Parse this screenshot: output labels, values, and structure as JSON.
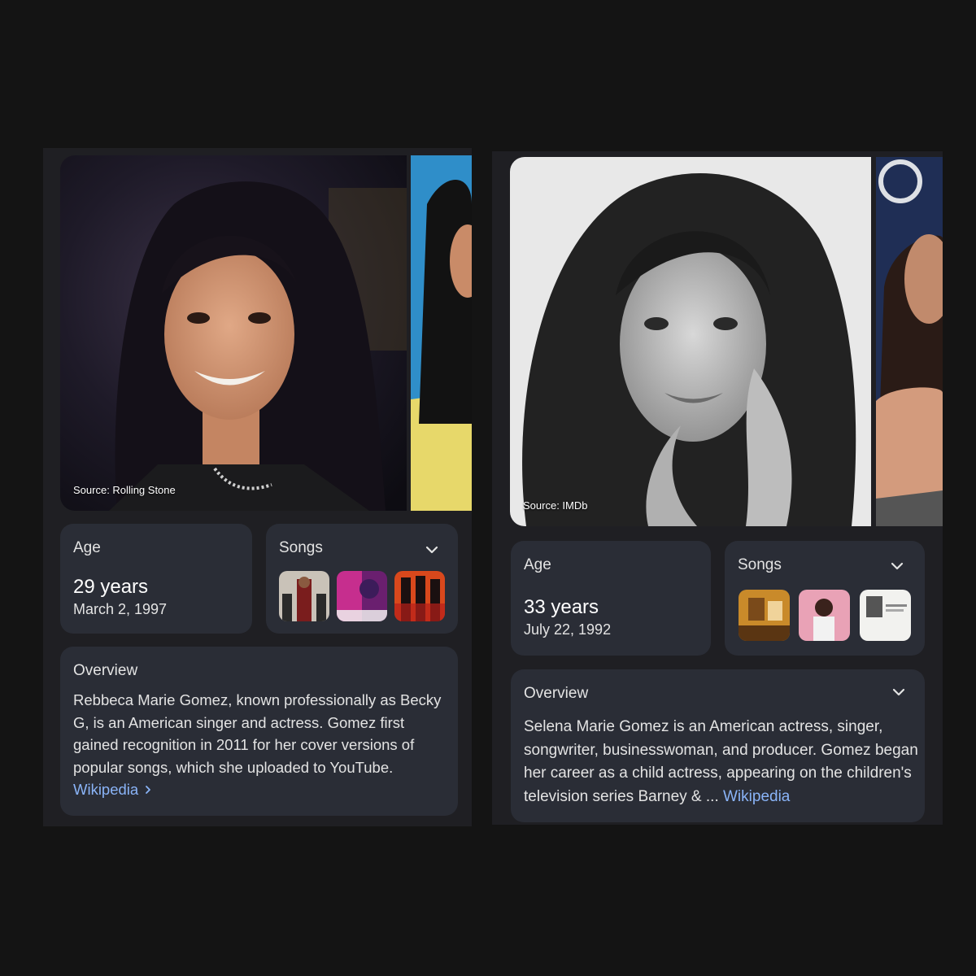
{
  "left_panel": {
    "photo_source": "Source: Rolling Stone",
    "age": {
      "label": "Age",
      "value": "29 years",
      "date": "March 2, 1997"
    },
    "songs": {
      "label": "Songs",
      "expand_icon": "chevron-down-icon"
    },
    "overview": {
      "label": "Overview",
      "text": "Rebbeca Marie Gomez, known professionally as Becky G, is an American singer and actress. Gomez first gained recognition in 2011 for her cover versions of popular songs, which she uploaded to YouTube.",
      "link": "Wikipedia",
      "link_icon": "chevron-right-icon"
    }
  },
  "right_panel": {
    "photo_source": "Source: IMDb",
    "age": {
      "label": "Age",
      "value": "33 years",
      "date": "July 22, 1992"
    },
    "songs": {
      "label": "Songs",
      "expand_icon": "chevron-down-icon"
    },
    "overview": {
      "label": "Overview",
      "text": "Selena Marie Gomez is an American actress, singer, songwriter, businesswoman, and producer. Gomez began her career as a child actress, appearing on the children's television series Barney & ...",
      "link": "Wikipedia",
      "expand_icon": "chevron-down-icon"
    }
  },
  "colors": {
    "background": "#141414",
    "panel": "#1f1f23",
    "card": "#2a2d36",
    "link": "#8ab4f8"
  }
}
